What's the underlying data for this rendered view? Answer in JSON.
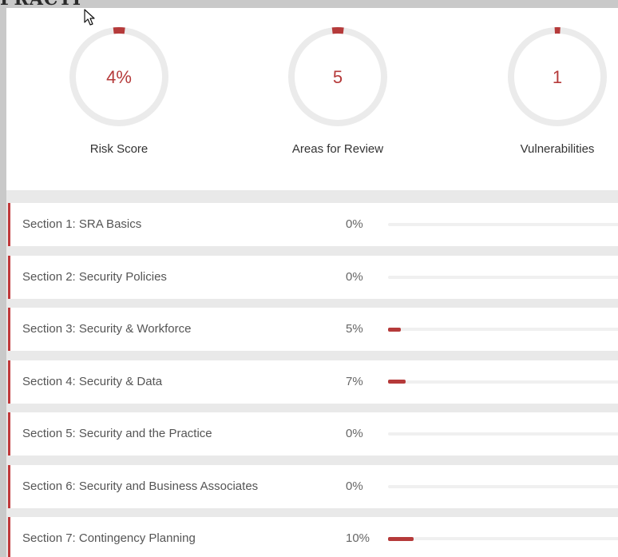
{
  "metrics": [
    {
      "value": "4%",
      "label": "Risk Score",
      "fraction": 0.04
    },
    {
      "value": "5",
      "label": "Areas for Review",
      "fraction": 0.04
    },
    {
      "value": "1",
      "label": "Vulnerabilities",
      "fraction": 0.02
    }
  ],
  "sections": [
    {
      "name": "Section 1: SRA Basics",
      "percent": "0%",
      "progress": 0
    },
    {
      "name": "Section 2: Security Policies",
      "percent": "0%",
      "progress": 0
    },
    {
      "name": "Section 3: Security & Workforce",
      "percent": "5%",
      "progress": 0.05
    },
    {
      "name": "Section 4: Security & Data",
      "percent": "7%",
      "progress": 0.07
    },
    {
      "name": "Section 5: Security and the Practice",
      "percent": "0%",
      "progress": 0
    },
    {
      "name": "Section 6: Security and Business Associates",
      "percent": "0%",
      "progress": 0
    },
    {
      "name": "Section 7: Contingency Planning",
      "percent": "10%",
      "progress": 0.1
    }
  ],
  "colors": {
    "accent": "#b53a3a",
    "ring_track": "#ebebeb",
    "row_border": "#c0393b",
    "page_bg": "#e9e9e9"
  },
  "icons": {
    "cursor": "mouse-pointer-icon"
  }
}
